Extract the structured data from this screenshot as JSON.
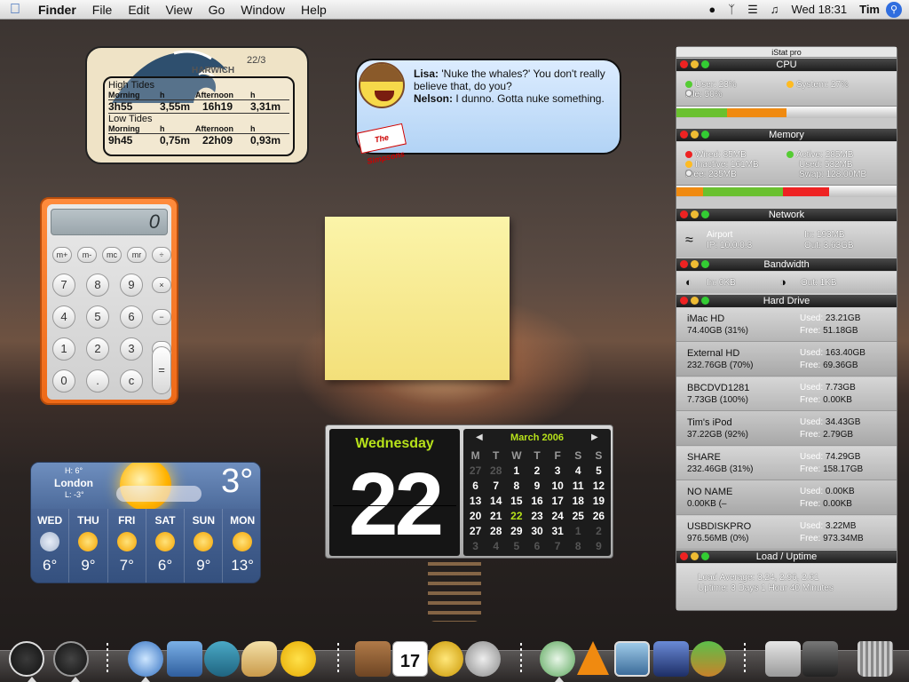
{
  "menubar": {
    "app": "Finder",
    "items": [
      "File",
      "Edit",
      "View",
      "Go",
      "Window",
      "Help"
    ],
    "clock": "Wed 18:31",
    "user": "Tim"
  },
  "tides": {
    "location": "HARWICH",
    "date": "22/3",
    "high_label": "High Tides",
    "low_label": "Low Tides",
    "col_morning": "Morning",
    "col_h": "h",
    "col_afternoon": "Afternoon",
    "high": {
      "m_time": "3h55",
      "m_height": "3,55m",
      "a_time": "16h19",
      "a_height": "3,31m"
    },
    "low": {
      "m_time": "9h45",
      "m_height": "0,75m",
      "a_time": "22h09",
      "a_height": "0,93m"
    }
  },
  "simpsons": {
    "logo": "The Simpsons",
    "line1_speaker": "Lisa:",
    "line1_text": "'Nuke the whales?' You don't really believe that, do you?",
    "line2_speaker": "Nelson:",
    "line2_text": "I dunno. Gotta nuke something."
  },
  "calculator": {
    "display": "0",
    "keys": [
      "m+",
      "m-",
      "mc",
      "mr",
      "÷",
      "7",
      "8",
      "9",
      "×",
      "4",
      "5",
      "6",
      "−",
      "1",
      "2",
      "3",
      "+",
      "0",
      ".",
      "c",
      "="
    ]
  },
  "weather": {
    "city": "London",
    "hi": "H: 6°",
    "lo": "L: -3°",
    "current": "3°",
    "days": [
      {
        "name": "WED",
        "temp": "6°",
        "icon": "rain-icon"
      },
      {
        "name": "THU",
        "temp": "9°",
        "icon": "sun-icon"
      },
      {
        "name": "FRI",
        "temp": "7°",
        "icon": "sun-icon"
      },
      {
        "name": "SAT",
        "temp": "6°",
        "icon": "sun-icon"
      },
      {
        "name": "SUN",
        "temp": "9°",
        "icon": "sun-icon"
      },
      {
        "name": "MON",
        "temp": "13°",
        "icon": "sun-icon"
      }
    ]
  },
  "calendar": {
    "weekday": "Wednesday",
    "day": "22",
    "month": "March 2006",
    "headers": [
      "M",
      "T",
      "W",
      "T",
      "F",
      "S",
      "S"
    ],
    "cells": [
      [
        "27",
        "o"
      ],
      [
        "28",
        "o"
      ],
      [
        "1",
        "c"
      ],
      [
        "2",
        "c"
      ],
      [
        "3",
        "c"
      ],
      [
        "4",
        "c"
      ],
      [
        "5",
        "c"
      ],
      [
        "6",
        "c"
      ],
      [
        "7",
        "c"
      ],
      [
        "8",
        "c"
      ],
      [
        "9",
        "c"
      ],
      [
        "10",
        "c"
      ],
      [
        "11",
        "c"
      ],
      [
        "12",
        "c"
      ],
      [
        "13",
        "c"
      ],
      [
        "14",
        "c"
      ],
      [
        "15",
        "c"
      ],
      [
        "16",
        "c"
      ],
      [
        "17",
        "c"
      ],
      [
        "18",
        "c"
      ],
      [
        "19",
        "c"
      ],
      [
        "20",
        "c"
      ],
      [
        "21",
        "c"
      ],
      [
        "22",
        "t"
      ],
      [
        "23",
        "c"
      ],
      [
        "24",
        "c"
      ],
      [
        "25",
        "c"
      ],
      [
        "26",
        "c"
      ],
      [
        "27",
        "c"
      ],
      [
        "28",
        "c"
      ],
      [
        "29",
        "c"
      ],
      [
        "30",
        "c"
      ],
      [
        "31",
        "c"
      ],
      [
        "1",
        "o"
      ],
      [
        "2",
        "o"
      ],
      [
        "3",
        "o"
      ],
      [
        "4",
        "o"
      ],
      [
        "5",
        "o"
      ],
      [
        "6",
        "o"
      ],
      [
        "7",
        "o"
      ],
      [
        "8",
        "o"
      ],
      [
        "9",
        "o"
      ]
    ]
  },
  "istat": {
    "title": "iStat pro",
    "cpu": {
      "header": "CPU",
      "user": "User: 23%",
      "idle": "Idle: 50%",
      "system": "System: 27%",
      "user_pct": 23,
      "system_pct": 27
    },
    "memory": {
      "header": "Memory",
      "wired": "Wired: 85MB",
      "inactive": "Inactive: 161MB",
      "free": "Free: 235MB",
      "active": "Active: 285MB",
      "used": "Used: 532MB",
      "swap": "Swap: 128.00MB"
    },
    "network": {
      "header": "Network",
      "iface": "Airport",
      "ip": "IP: 10.0.0.3",
      "in": "In: 193MB",
      "out": "Out: 3.63GB"
    },
    "bandwidth": {
      "header": "Bandwidth",
      "in": "In: 0KB",
      "out": "Out: 1KB"
    },
    "harddrive": {
      "header": "Hard Drive",
      "drives": [
        {
          "name": "iMac HD",
          "size": "74.40GB (31%)",
          "used": "23.21GB",
          "free": "51.18GB"
        },
        {
          "name": "External HD",
          "size": "232.76GB (70%)",
          "used": "163.40GB",
          "free": "69.36GB"
        },
        {
          "name": "BBCDVD1281",
          "size": "7.73GB (100%)",
          "used": "7.73GB",
          "free": "0.00KB"
        },
        {
          "name": "Tim's iPod",
          "size": "37.22GB (92%)",
          "used": "34.43GB",
          "free": "2.79GB"
        },
        {
          "name": "SHARE",
          "size": "232.46GB (31%)",
          "used": "74.29GB",
          "free": "158.17GB"
        },
        {
          "name": "NO NAME",
          "size": "0.00KB (–",
          "used": "0.00KB",
          "free": "0.00KB"
        },
        {
          "name": "USBDISKPRO",
          "size": "976.56MB (0%)",
          "used": "3.22MB",
          "free": "973.34MB"
        }
      ],
      "used_label": "Used:",
      "free_label": "Free:"
    },
    "load": {
      "header": "Load / Uptime",
      "avg": "Load Average: 3.24, 2.96, 2.61",
      "uptime": "Uptime: 3 Days 1 Hour 40 Minutes"
    }
  },
  "dock": {
    "items": [
      "dashboard-icon",
      "clock-icon",
      "safari-icon",
      "mail-icon",
      "ichat-icon",
      "taco-icon",
      "duck-icon",
      "address-book-icon",
      "ical-icon",
      "alarm-icon",
      "sync-icon",
      "itunes-icon",
      "vlc-icon",
      "iphoto-icon",
      "imovie-icon",
      "island-icon",
      "drive-icon",
      "network-drive-icon",
      "trash-icon"
    ],
    "ical_date": "17"
  }
}
